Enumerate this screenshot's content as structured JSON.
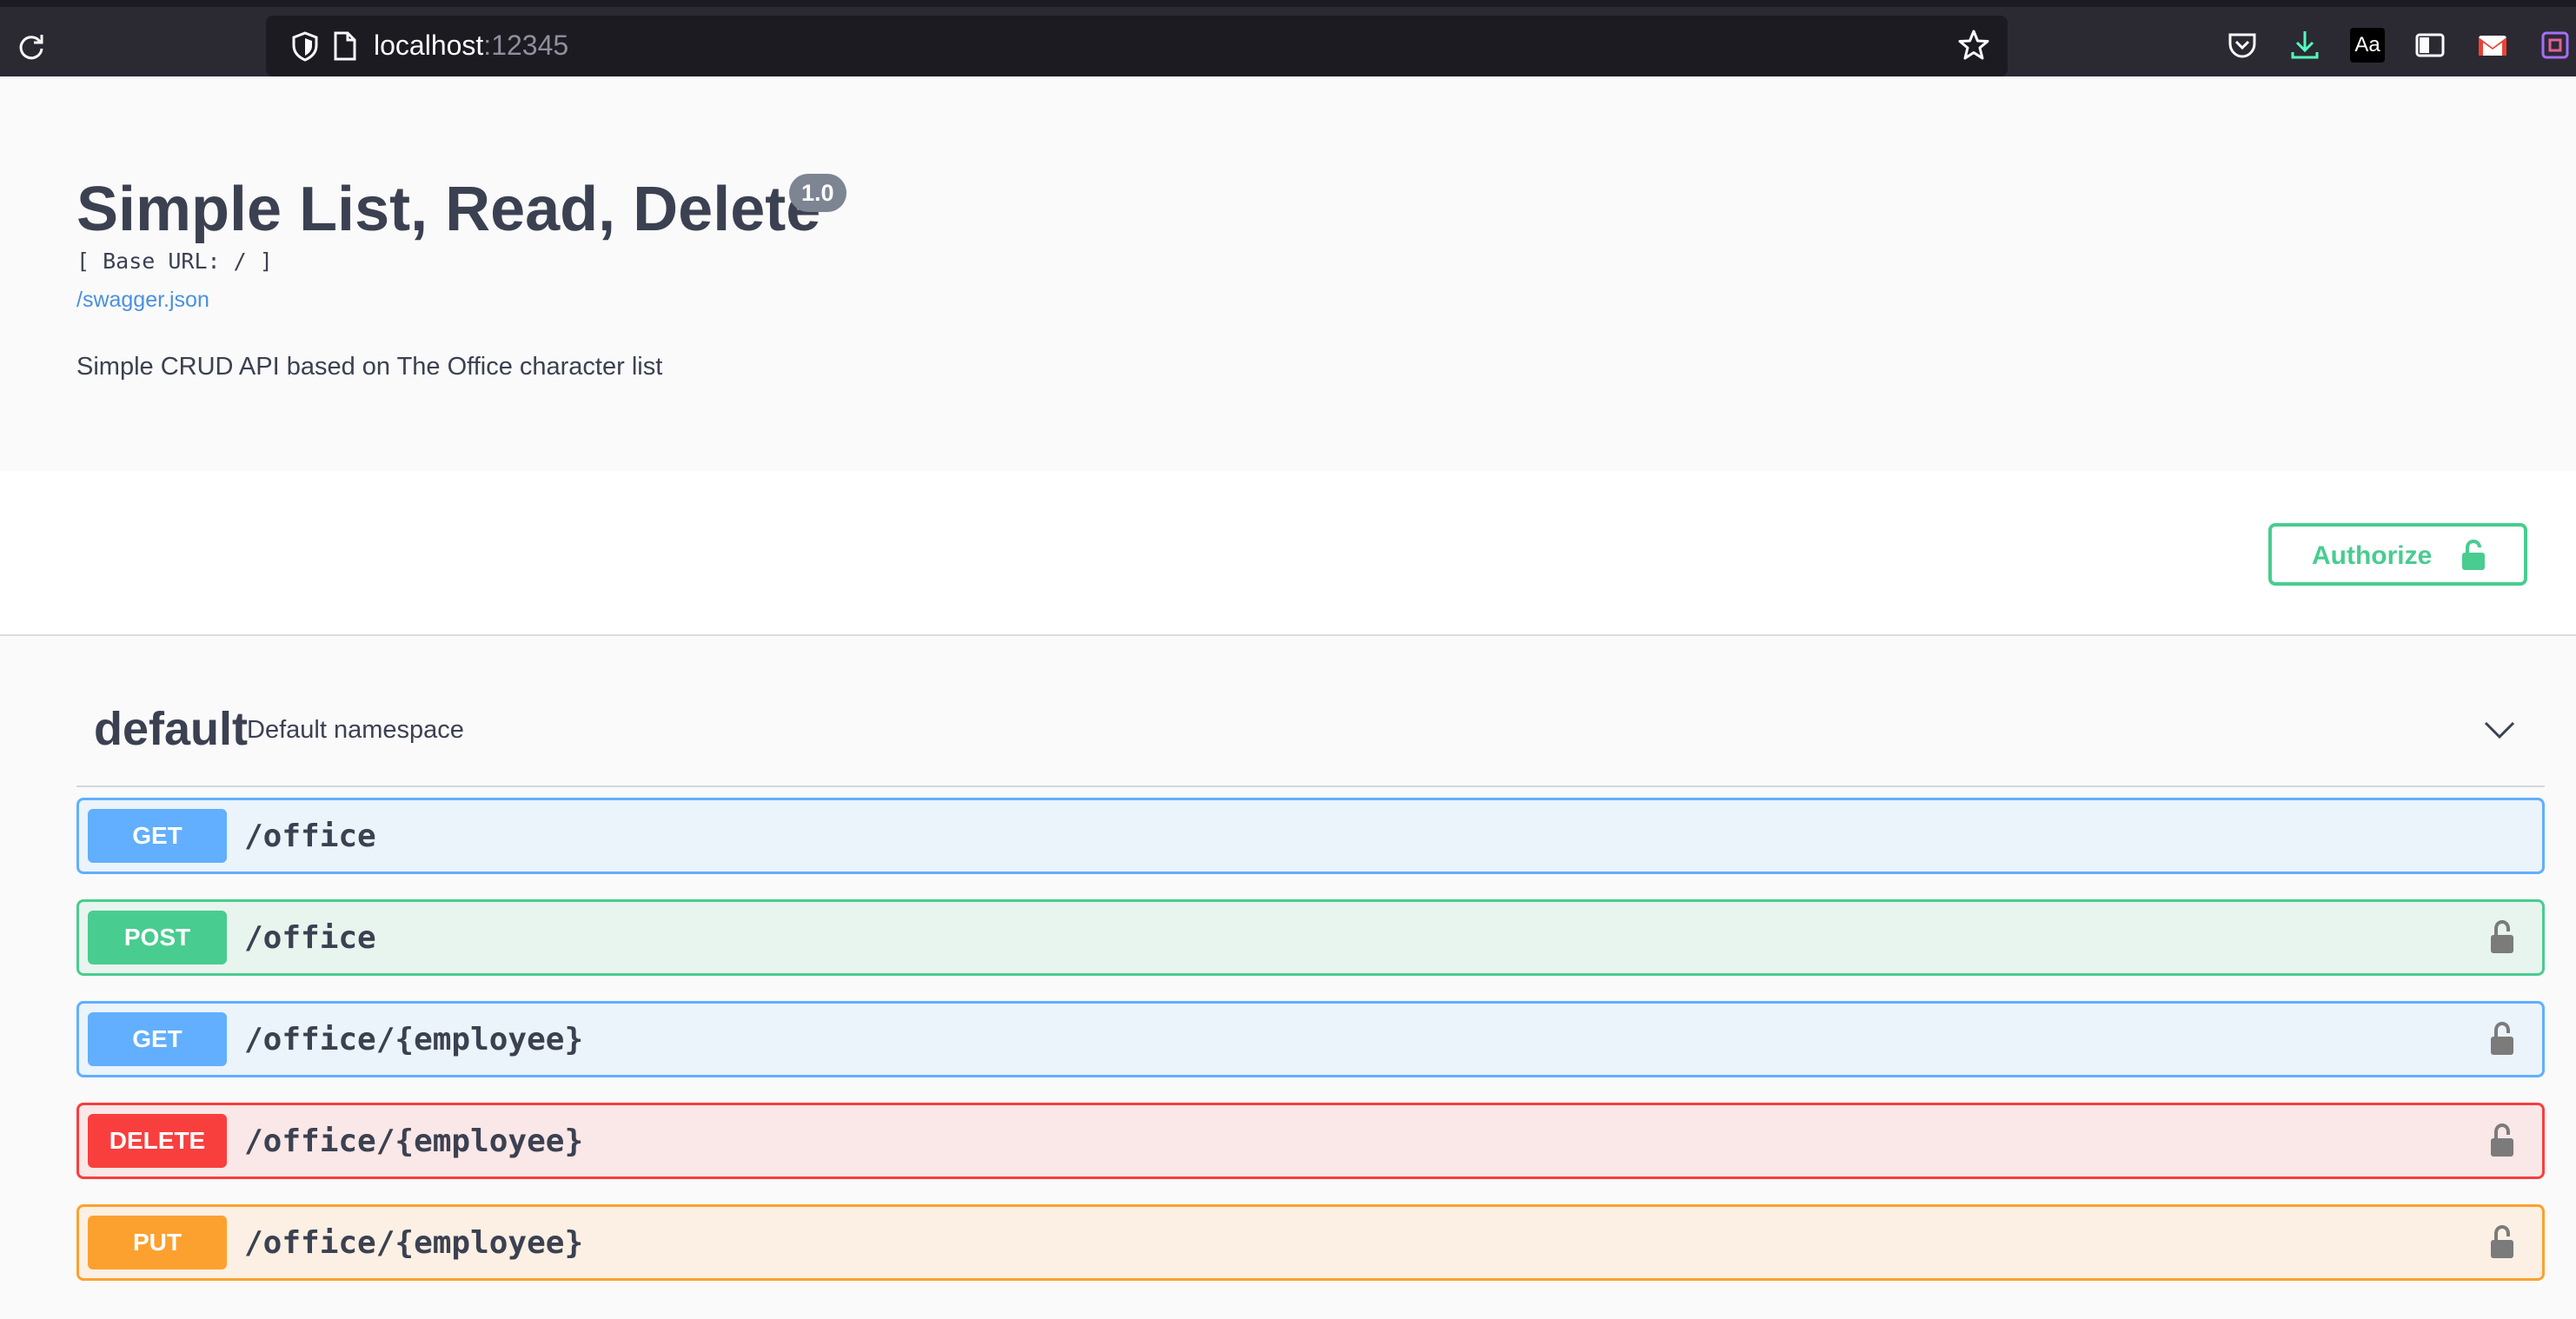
{
  "browser": {
    "url_host": "localhost",
    "url_port": ":12345"
  },
  "info": {
    "title": "Simple List, Read, Delete",
    "version": "1.0",
    "base_url": "[ Base URL: / ]",
    "spec_link": "/swagger.json",
    "description": "Simple CRUD API based on The Office character list"
  },
  "authorize": {
    "label": "Authorize"
  },
  "tag": {
    "name": "default",
    "description": "Default namespace"
  },
  "operations": [
    {
      "method": "GET",
      "path": "/office",
      "locked": false
    },
    {
      "method": "POST",
      "path": "/office",
      "locked": true
    },
    {
      "method": "GET",
      "path": "/office/{employee}",
      "locked": true
    },
    {
      "method": "DELETE",
      "path": "/office/{employee}",
      "locked": true
    },
    {
      "method": "PUT",
      "path": "/office/{employee}",
      "locked": true
    }
  ],
  "colors": {
    "get": "#61affe",
    "post": "#49cc90",
    "delete": "#f93e3e",
    "put": "#fca130",
    "text": "#3b4151"
  },
  "icons": [
    "reload-icon",
    "shield-icon",
    "page-icon",
    "star-icon",
    "pocket-icon",
    "download-icon",
    "reader-icon",
    "sidebar-icon",
    "mail-icon",
    "extension-icon",
    "lock-icon",
    "chevron-down-icon"
  ]
}
